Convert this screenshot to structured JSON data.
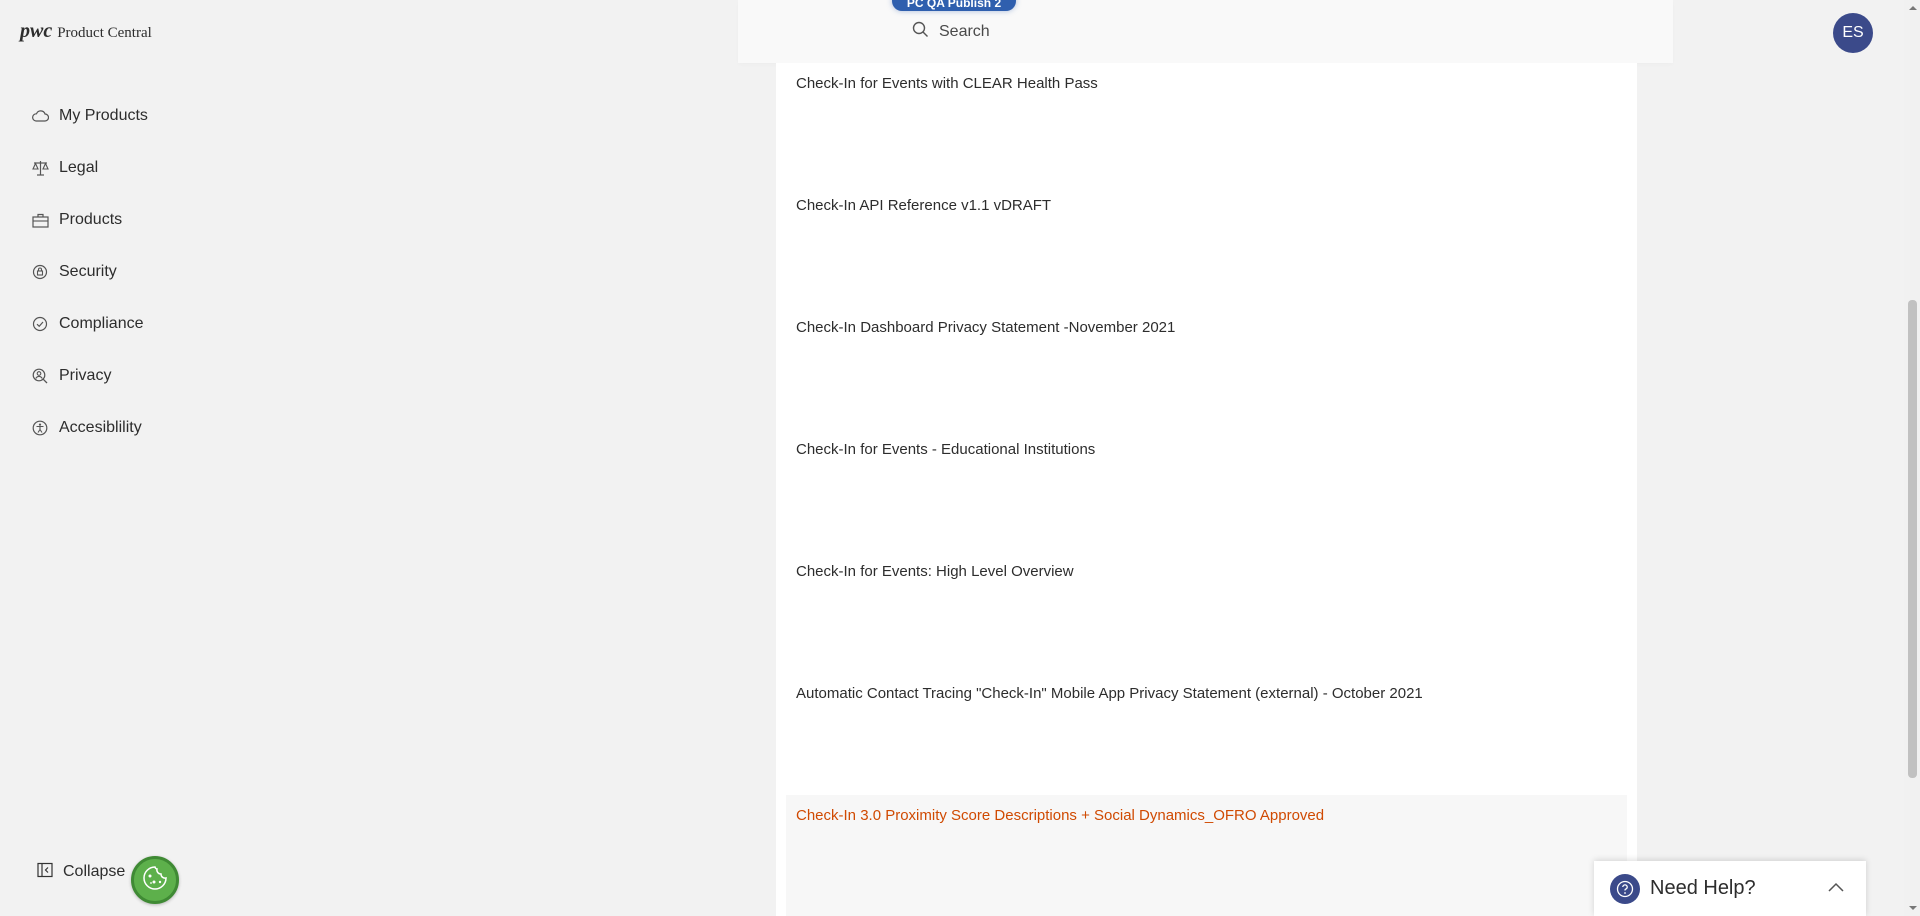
{
  "header": {
    "logo_mark": "pwc",
    "app_name": "Product Central",
    "environment_badge": "PC QA Publish 2",
    "search_label": "Search",
    "avatar_initials": "ES"
  },
  "sidebar": {
    "items": [
      {
        "label": "My Products",
        "icon": "cloud-icon"
      },
      {
        "label": "Legal",
        "icon": "scales-icon"
      },
      {
        "label": "Products",
        "icon": "briefcase-icon"
      },
      {
        "label": "Security",
        "icon": "shield-icon"
      },
      {
        "label": "Compliance",
        "icon": "check-circle-icon"
      },
      {
        "label": "Privacy",
        "icon": "user-search-icon"
      },
      {
        "label": "Accesiblility",
        "icon": "accessibility-icon"
      }
    ],
    "collapse_label": "Collapse",
    "cookie_icon": "cookie-icon"
  },
  "documents": [
    {
      "title": "Check-In for Events with CLEAR Health Pass",
      "active": false
    },
    {
      "title": "Check-In API Reference v1.1 vDRAFT",
      "active": false
    },
    {
      "title": "Check-In Dashboard Privacy Statement -November 2021",
      "active": false
    },
    {
      "title": "Check-In for Events - Educational Institutions",
      "active": false
    },
    {
      "title": "Check-In for Events: High Level Overview",
      "active": false
    },
    {
      "title": "Automatic Contact Tracing \"Check-In\" Mobile App Privacy Statement (external) - October 2021",
      "active": false
    },
    {
      "title": "Check-In 3.0 Proximity Score Descriptions + Social Dynamics_OFRO Approved",
      "active": true
    }
  ],
  "help": {
    "label": "Need Help?"
  },
  "colors": {
    "accent": "#d04a02",
    "avatar": "#3b4a8a",
    "badge": "#2f5fae",
    "cookie": "#5db04b"
  }
}
